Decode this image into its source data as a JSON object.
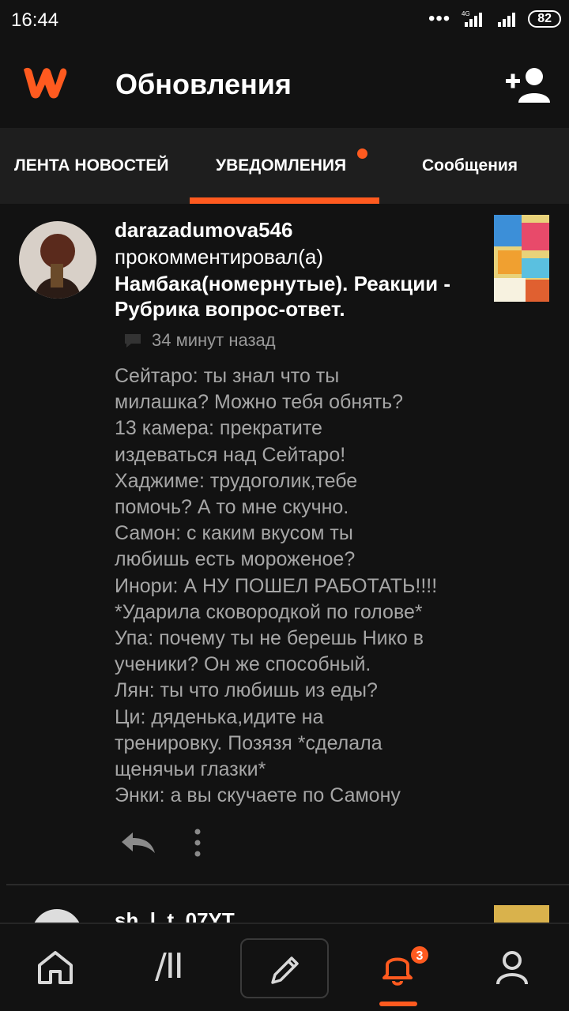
{
  "status_bar": {
    "time": "16:44",
    "signal_dots": "•••",
    "battery": "82"
  },
  "app_bar": {
    "title": "Обновления",
    "logo_icon": "wattpad-w-logo",
    "action_icon": "add-user-icon"
  },
  "tabs": [
    {
      "label": "ЛЕНТА НОВОСТЕЙ",
      "active": false
    },
    {
      "label": "УВЕДОМЛЕНИЯ",
      "active": true,
      "has_dot": true
    },
    {
      "label": "Сообщения",
      "active": false
    }
  ],
  "notification": {
    "username": "darazadumova546",
    "action": "прокомментировал(а)",
    "story_title": "Намбака(номернутые). Реакции - Рубрика вопрос-ответ.",
    "time_ago": "34 минут назад",
    "comment": "Сейтаро: ты знал что ты\nмилашка? Можно тебя обнять?\n13 камера: прекратите\nиздеваться над Сейтаро!\nХаджиме: трудоголик,тебе\nпомочь? А то мне скучно.\nСамон: с каким вкусом ты\nлюбишь есть мороженое?\nИнори: А НУ ПОШЕЛ РАБОТАТЬ!!!!\n*Ударила сковородкой по голове*\nУпа: почему ты не берешь Нико в\nученики? Он же способный.\nЛян: ты что любишь из еды?\nЦи: дяденька,идите на\nтренировку. Позязя *сделала\nщенячьи глазки*\nЭнки: а вы скучаете по Самону"
  },
  "next_notification": {
    "partial_text": "sh_l_t_07YT..."
  },
  "bottom_nav": {
    "items": [
      "home-icon",
      "library-icon",
      "write-icon",
      "notifications-icon",
      "profile-icon"
    ],
    "library_glyph": "/II",
    "notification_badge": "3",
    "accent_color": "#ff5a1f"
  }
}
